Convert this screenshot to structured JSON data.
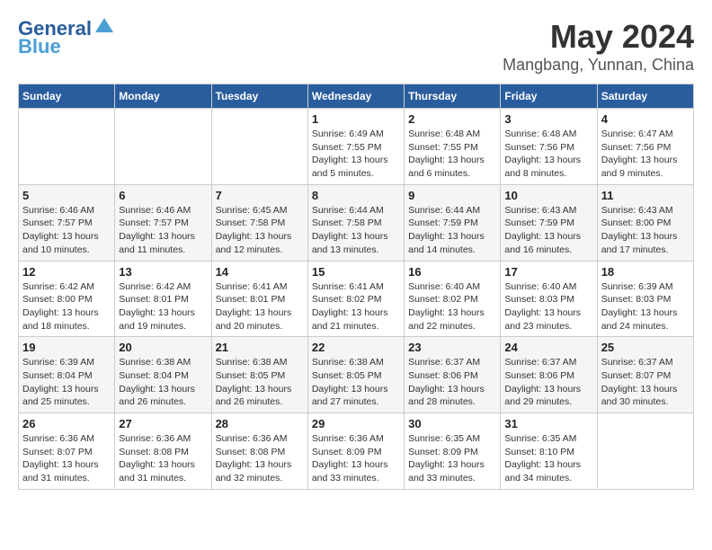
{
  "logo": {
    "line1": "General",
    "line2": "Blue"
  },
  "title": "May 2024",
  "subtitle": "Mangbang, Yunnan, China",
  "weekdays": [
    "Sunday",
    "Monday",
    "Tuesday",
    "Wednesday",
    "Thursday",
    "Friday",
    "Saturday"
  ],
  "weeks": [
    [
      {
        "day": "",
        "info": ""
      },
      {
        "day": "",
        "info": ""
      },
      {
        "day": "",
        "info": ""
      },
      {
        "day": "1",
        "info": "Sunrise: 6:49 AM\nSunset: 7:55 PM\nDaylight: 13 hours\nand 5 minutes."
      },
      {
        "day": "2",
        "info": "Sunrise: 6:48 AM\nSunset: 7:55 PM\nDaylight: 13 hours\nand 6 minutes."
      },
      {
        "day": "3",
        "info": "Sunrise: 6:48 AM\nSunset: 7:56 PM\nDaylight: 13 hours\nand 8 minutes."
      },
      {
        "day": "4",
        "info": "Sunrise: 6:47 AM\nSunset: 7:56 PM\nDaylight: 13 hours\nand 9 minutes."
      }
    ],
    [
      {
        "day": "5",
        "info": "Sunrise: 6:46 AM\nSunset: 7:57 PM\nDaylight: 13 hours\nand 10 minutes."
      },
      {
        "day": "6",
        "info": "Sunrise: 6:46 AM\nSunset: 7:57 PM\nDaylight: 13 hours\nand 11 minutes."
      },
      {
        "day": "7",
        "info": "Sunrise: 6:45 AM\nSunset: 7:58 PM\nDaylight: 13 hours\nand 12 minutes."
      },
      {
        "day": "8",
        "info": "Sunrise: 6:44 AM\nSunset: 7:58 PM\nDaylight: 13 hours\nand 13 minutes."
      },
      {
        "day": "9",
        "info": "Sunrise: 6:44 AM\nSunset: 7:59 PM\nDaylight: 13 hours\nand 14 minutes."
      },
      {
        "day": "10",
        "info": "Sunrise: 6:43 AM\nSunset: 7:59 PM\nDaylight: 13 hours\nand 16 minutes."
      },
      {
        "day": "11",
        "info": "Sunrise: 6:43 AM\nSunset: 8:00 PM\nDaylight: 13 hours\nand 17 minutes."
      }
    ],
    [
      {
        "day": "12",
        "info": "Sunrise: 6:42 AM\nSunset: 8:00 PM\nDaylight: 13 hours\nand 18 minutes."
      },
      {
        "day": "13",
        "info": "Sunrise: 6:42 AM\nSunset: 8:01 PM\nDaylight: 13 hours\nand 19 minutes."
      },
      {
        "day": "14",
        "info": "Sunrise: 6:41 AM\nSunset: 8:01 PM\nDaylight: 13 hours\nand 20 minutes."
      },
      {
        "day": "15",
        "info": "Sunrise: 6:41 AM\nSunset: 8:02 PM\nDaylight: 13 hours\nand 21 minutes."
      },
      {
        "day": "16",
        "info": "Sunrise: 6:40 AM\nSunset: 8:02 PM\nDaylight: 13 hours\nand 22 minutes."
      },
      {
        "day": "17",
        "info": "Sunrise: 6:40 AM\nSunset: 8:03 PM\nDaylight: 13 hours\nand 23 minutes."
      },
      {
        "day": "18",
        "info": "Sunrise: 6:39 AM\nSunset: 8:03 PM\nDaylight: 13 hours\nand 24 minutes."
      }
    ],
    [
      {
        "day": "19",
        "info": "Sunrise: 6:39 AM\nSunset: 8:04 PM\nDaylight: 13 hours\nand 25 minutes."
      },
      {
        "day": "20",
        "info": "Sunrise: 6:38 AM\nSunset: 8:04 PM\nDaylight: 13 hours\nand 26 minutes."
      },
      {
        "day": "21",
        "info": "Sunrise: 6:38 AM\nSunset: 8:05 PM\nDaylight: 13 hours\nand 26 minutes."
      },
      {
        "day": "22",
        "info": "Sunrise: 6:38 AM\nSunset: 8:05 PM\nDaylight: 13 hours\nand 27 minutes."
      },
      {
        "day": "23",
        "info": "Sunrise: 6:37 AM\nSunset: 8:06 PM\nDaylight: 13 hours\nand 28 minutes."
      },
      {
        "day": "24",
        "info": "Sunrise: 6:37 AM\nSunset: 8:06 PM\nDaylight: 13 hours\nand 29 minutes."
      },
      {
        "day": "25",
        "info": "Sunrise: 6:37 AM\nSunset: 8:07 PM\nDaylight: 13 hours\nand 30 minutes."
      }
    ],
    [
      {
        "day": "26",
        "info": "Sunrise: 6:36 AM\nSunset: 8:07 PM\nDaylight: 13 hours\nand 31 minutes."
      },
      {
        "day": "27",
        "info": "Sunrise: 6:36 AM\nSunset: 8:08 PM\nDaylight: 13 hours\nand 31 minutes."
      },
      {
        "day": "28",
        "info": "Sunrise: 6:36 AM\nSunset: 8:08 PM\nDaylight: 13 hours\nand 32 minutes."
      },
      {
        "day": "29",
        "info": "Sunrise: 6:36 AM\nSunset: 8:09 PM\nDaylight: 13 hours\nand 33 minutes."
      },
      {
        "day": "30",
        "info": "Sunrise: 6:35 AM\nSunset: 8:09 PM\nDaylight: 13 hours\nand 33 minutes."
      },
      {
        "day": "31",
        "info": "Sunrise: 6:35 AM\nSunset: 8:10 PM\nDaylight: 13 hours\nand 34 minutes."
      },
      {
        "day": "",
        "info": ""
      }
    ]
  ]
}
